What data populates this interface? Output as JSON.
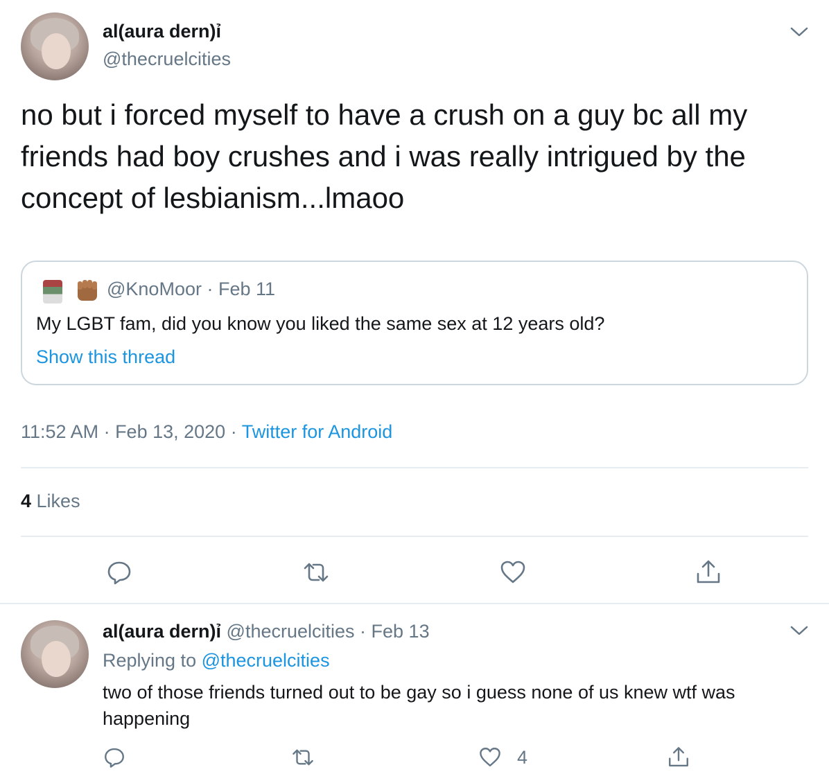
{
  "main_tweet": {
    "display_name": "al(aura dern)ỉ",
    "handle": "@thecruelcities",
    "text": "no but i forced myself to have a crush on a guy bc all my friends had boy crushes and i was really intrigued by the concept of lesbianism...lmaoo",
    "quote": {
      "handle_date": "@KnoMoor · Feb 11",
      "text": "My LGBT fam, did you know you liked the same sex at 12 years old?",
      "show_thread": "Show this thread"
    },
    "time_date": "11:52 AM · Feb 13, 2020 · ",
    "source": "Twitter for Android",
    "likes_count": "4",
    "likes_label": " Likes"
  },
  "reply": {
    "display_name": "al(aura dern)ỉ",
    "handle_date": " @thecruelcities · Feb 13",
    "replying_prefix": "Replying to ",
    "replying_handle": "@thecruelcities",
    "text": "two of those friends turned out to be gay so i guess none of us knew wtf was happening",
    "like_count": "4"
  },
  "icons": {
    "reply": "reply-icon",
    "retweet": "retweet-icon",
    "like": "heart-icon",
    "share": "share-icon",
    "more": "chevron-down-icon",
    "accent_color": "#1b95e0",
    "muted_color": "#657786"
  }
}
